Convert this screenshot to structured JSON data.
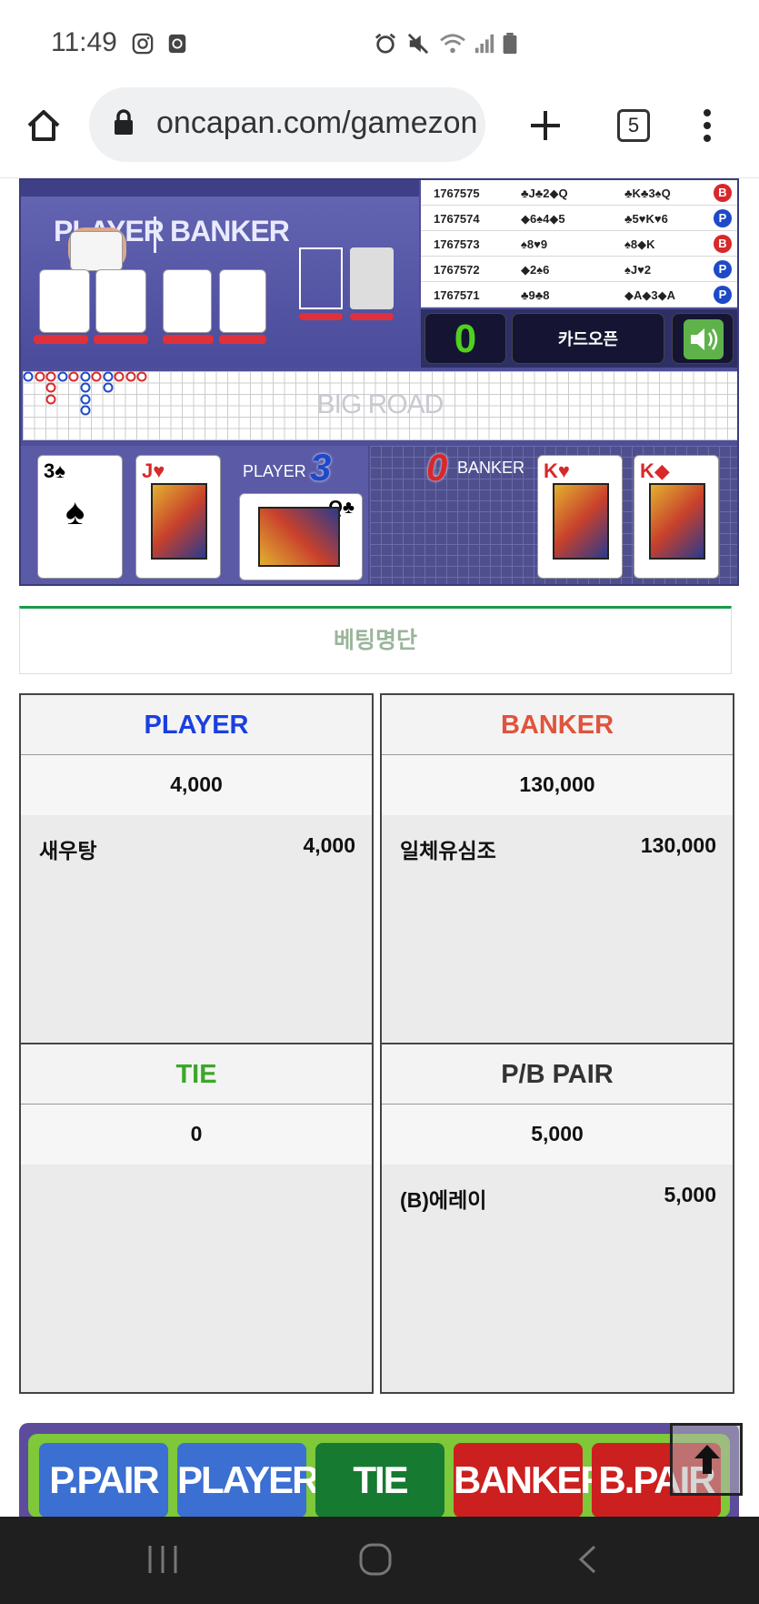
{
  "status_bar": {
    "time": "11:49"
  },
  "browser": {
    "url": "oncapan.com/gamezone",
    "tab_count": "5"
  },
  "game": {
    "history": [
      {
        "round": "1767575",
        "player_cards": "♣J♣2◆Q",
        "banker_cards": "♣K♣3♠Q",
        "result": "B"
      },
      {
        "round": "1767574",
        "player_cards": "◆6♠4◆5",
        "banker_cards": "♣5♥K♥6",
        "result": "P"
      },
      {
        "round": "1767573",
        "player_cards": "♠8♥9",
        "banker_cards": "♠8◆K",
        "result": "B"
      },
      {
        "round": "1767572",
        "player_cards": "◆2♠6",
        "banker_cards": "♠J♥2",
        "result": "P"
      },
      {
        "round": "1767571",
        "player_cards": "♣9♣8",
        "banker_cards": "◆A◆3◆A",
        "result": "P"
      }
    ],
    "timer_value": "0",
    "card_open_label": "카드오픈",
    "big_road_label": "BIG ROAD",
    "video_player_label": "PLAYER",
    "video_banker_label": "BANKER",
    "player_label": "PLAYER",
    "player_score": "3",
    "banker_label": "BANKER",
    "banker_score": "0",
    "player_cards": [
      "3♠",
      "J♥",
      "Q♣"
    ],
    "banker_cards": [
      "K♥",
      "K◆"
    ],
    "colors": {
      "banker": "#d8282a",
      "player": "#1e49c8"
    }
  },
  "betting_list": {
    "title": "베팅명단"
  },
  "panels": [
    {
      "title": "PLAYER",
      "color": "#1a3fe0",
      "total": "4,000",
      "entries": [
        {
          "name": "새우탕",
          "amount": "4,000"
        }
      ]
    },
    {
      "title": "BANKER",
      "color": "#e0533c",
      "total": "130,000",
      "entries": [
        {
          "name": "일체유심조",
          "amount": "130,000"
        }
      ]
    },
    {
      "title": "TIE",
      "color": "#3aa828",
      "total": "0",
      "entries": []
    },
    {
      "title": "P/B PAIR",
      "color": "#333333",
      "total": "5,000",
      "entries": [
        {
          "name": "(B)에레이",
          "amount": "5,000"
        }
      ]
    }
  ],
  "bet_buttons": [
    "P.PAIR",
    "PLAYER",
    "TIE",
    "BANKER",
    "B.PAIR"
  ],
  "bet_button_colors": [
    "#3b6fd1",
    "#3b6fd1",
    "#167a30",
    "#cc1f1f",
    "#cc1f1f"
  ],
  "icons": {
    "scroll_top": "arrow-up-icon"
  }
}
